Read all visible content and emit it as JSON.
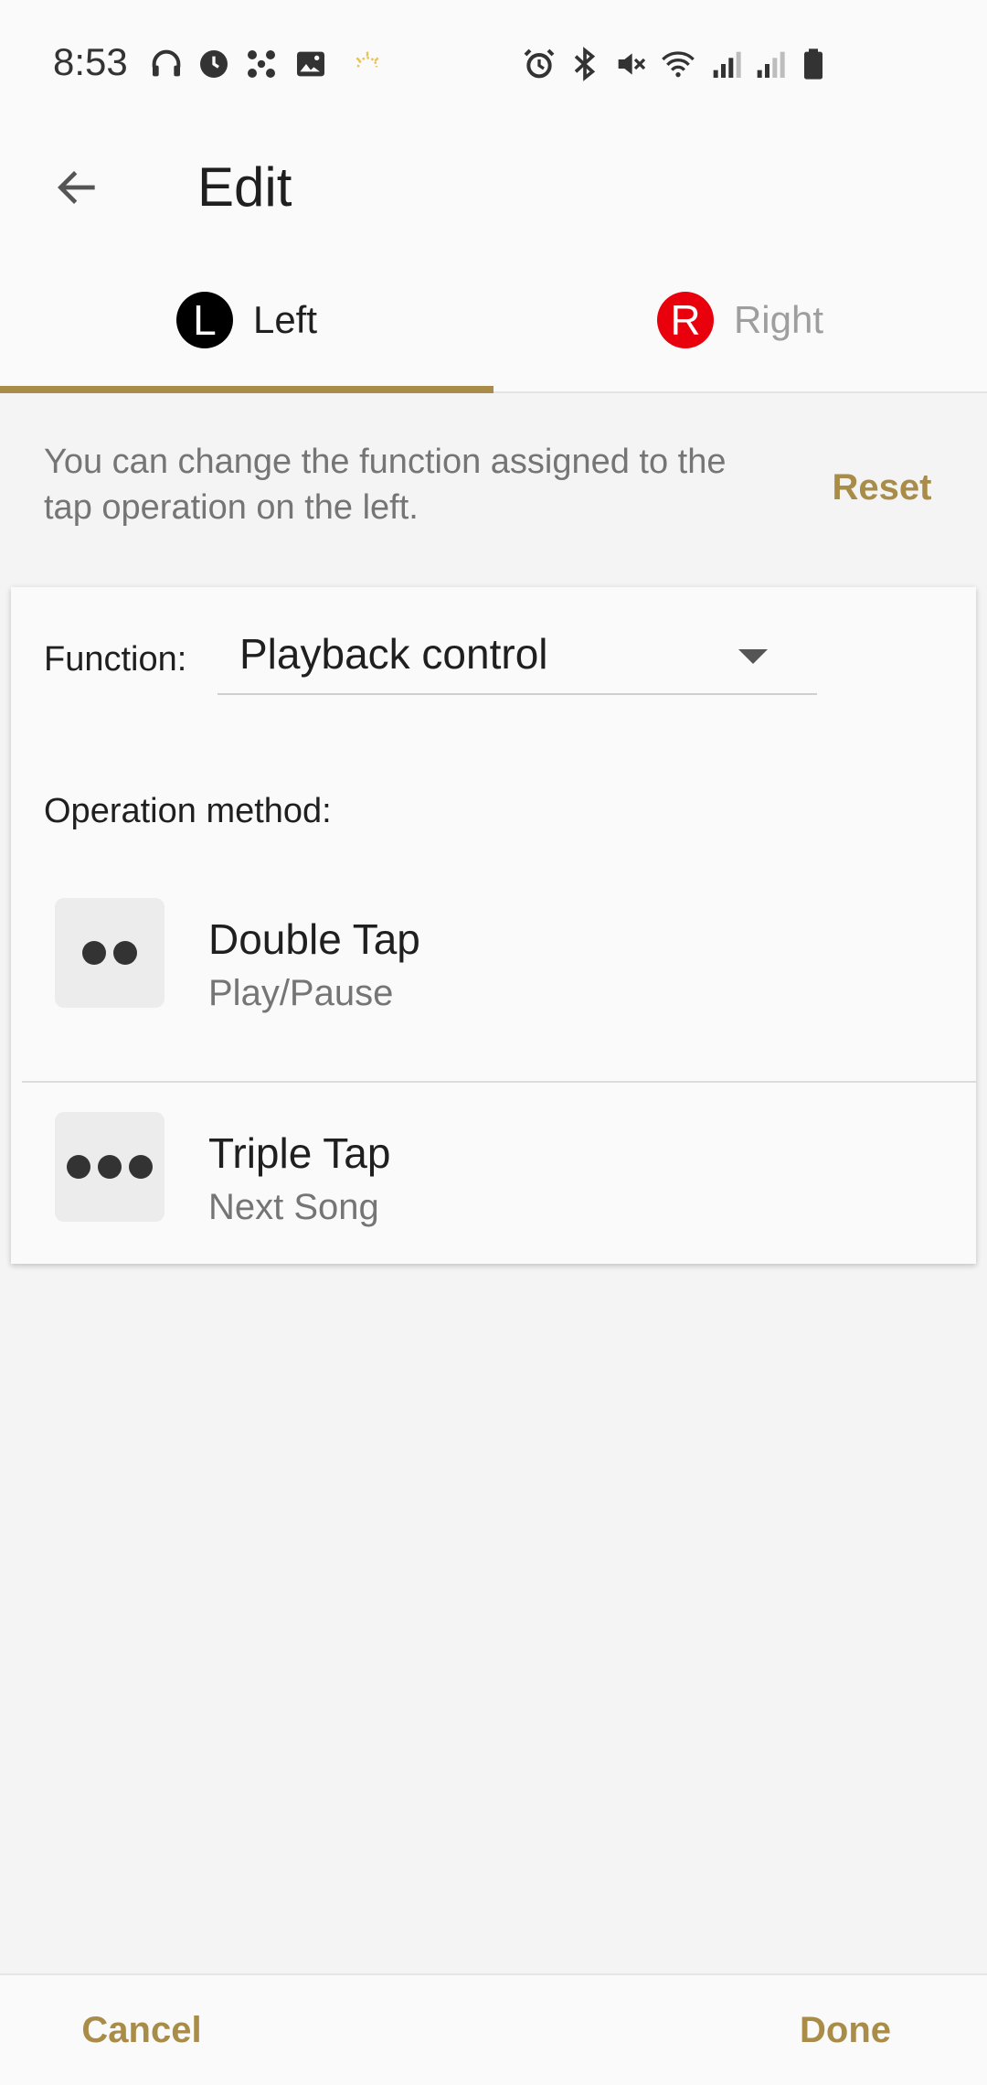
{
  "status_bar": {
    "time": "8:53",
    "left_icons": [
      "headphones-icon",
      "sync-icon",
      "fan-icon",
      "image-icon",
      "sun-icon"
    ],
    "right_icons": [
      "alarm-icon",
      "bluetooth-icon",
      "mute-icon",
      "wifi-icon",
      "signal-icon",
      "signal-icon",
      "battery-icon"
    ]
  },
  "app_bar": {
    "title": "Edit",
    "back_icon": "arrow-left-icon"
  },
  "tabs": [
    {
      "badge": "L",
      "label": "Left",
      "selected": true,
      "badge_color": "#000000"
    },
    {
      "badge": "R",
      "label": "Right",
      "selected": false,
      "badge_color": "#e8000d"
    }
  ],
  "description": "You can change the function assigned to the tap operation on the left.",
  "reset_label": "Reset",
  "card": {
    "function_label": "Function:",
    "function_value": "Playback control",
    "operation_heading": "Operation method:",
    "operations": [
      {
        "name": "Double Tap",
        "action": "Play/Pause",
        "dots": 2
      },
      {
        "name": "Triple Tap",
        "action": "Next Song",
        "dots": 3
      }
    ]
  },
  "footer": {
    "cancel_label": "Cancel",
    "done_label": "Done"
  },
  "colors": {
    "accent": "#a88c47",
    "right_badge": "#e8000d"
  }
}
